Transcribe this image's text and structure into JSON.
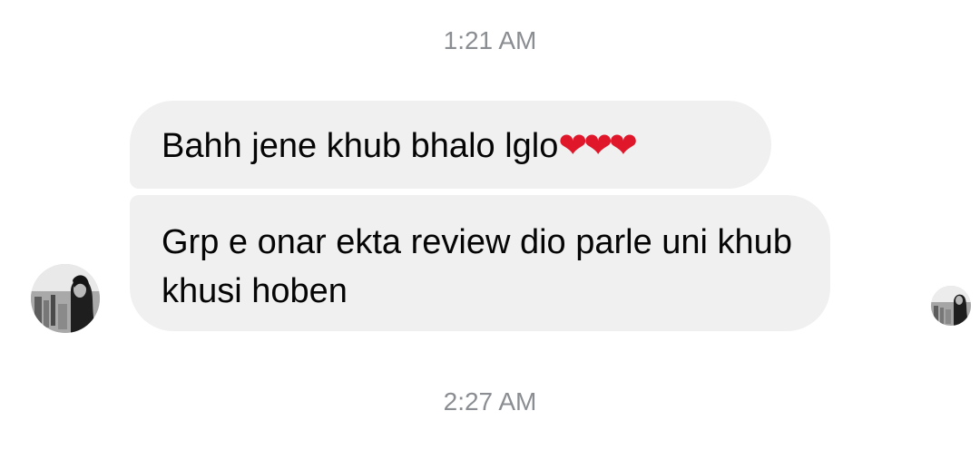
{
  "conversation": {
    "timestamps": {
      "first": "1:21 AM",
      "second": "2:27 AM"
    },
    "messages": [
      {
        "text": "Bahh jene khub bhalo lglo",
        "emoji": "❤❤❤"
      },
      {
        "text": "Grp e onar ekta review dio parle uni khub khusi hoben"
      }
    ],
    "sender_avatar_icon": "user-avatar-photo",
    "seen_avatar_icon": "read-receipt-avatar-photo"
  },
  "colors": {
    "bubble_bg": "#f0f0f0",
    "timestamp_text": "#8a8d91",
    "message_text": "#050505",
    "heart": "#e0162b"
  }
}
